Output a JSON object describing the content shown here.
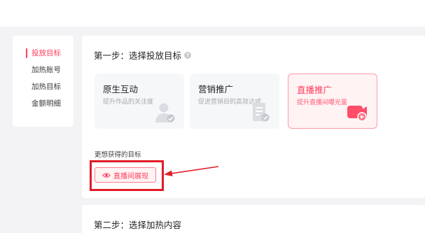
{
  "sidebar": {
    "items": [
      {
        "label": "投放目标",
        "active": true
      },
      {
        "label": "加热账号",
        "active": false
      },
      {
        "label": "加热目标",
        "active": false
      },
      {
        "label": "金额明细",
        "active": false
      }
    ]
  },
  "step1": {
    "title": "第一步：选择投放目标",
    "cards": [
      {
        "title": "原生互动",
        "subtitle": "提升作品的关注度",
        "icon": "user-icon",
        "selected": false
      },
      {
        "title": "营销推广",
        "subtitle": "促进营销目的高效达成",
        "icon": "document-icon",
        "selected": false
      },
      {
        "title": "直播推广",
        "subtitle": "提升直播间曝光量",
        "icon": "live-camera-icon",
        "selected": true
      }
    ],
    "more_label": "更想获得的目标",
    "tag": {
      "label": "直播间展现",
      "icon": "eye-icon",
      "selected": true
    }
  },
  "step2": {
    "title": "第二步：选择加热内容"
  },
  "colors": {
    "accent": "#ff3c5c",
    "highlight": "#e01c29",
    "background": "#f3f3f5"
  }
}
